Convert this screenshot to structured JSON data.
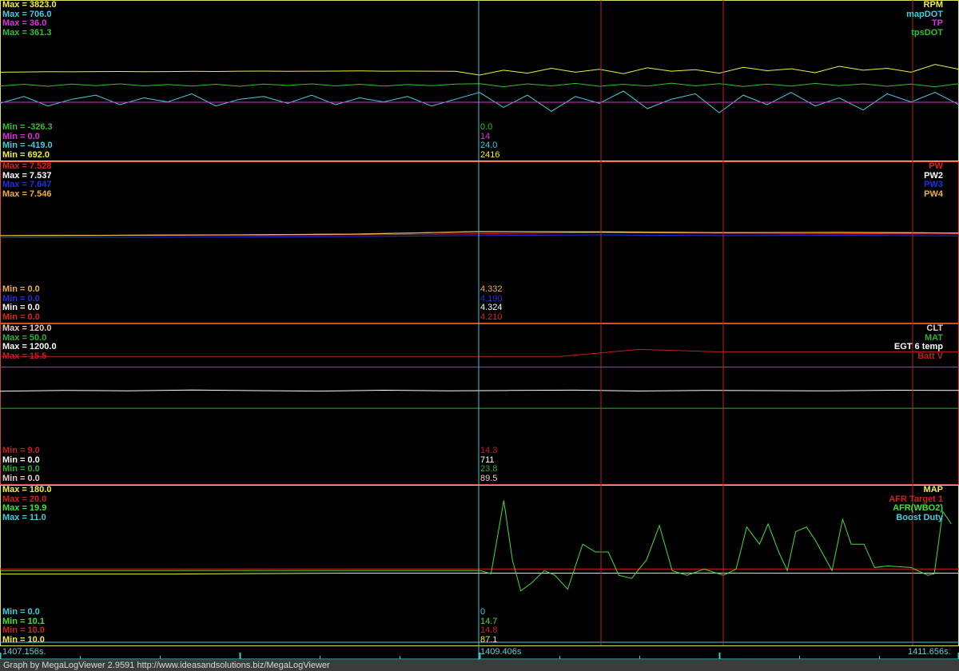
{
  "chart_data": {
    "type": "line",
    "title": "MegaLogViewer log graph",
    "x_range": [
      1407.156,
      1411.656
    ],
    "cursor_time_label": "1409.406s",
    "x_start_label": "1407.156s.",
    "x_end_label": "1411.656s.",
    "panels": [
      {
        "series": [
          {
            "name": "RPM",
            "color": "#f0f040",
            "max_label": "Max = 3823.0",
            "min_label": "Min = 692.0",
            "cursor_value": "2416",
            "max": 3823.0,
            "min": 692.0,
            "values": [
              2440,
              2445,
              2450,
              2448,
              2452,
              2455,
              2450,
              2452,
              2458,
              2455,
              2460,
              2462,
              2458,
              2460,
              2462,
              2465,
              2460,
              2462,
              2460,
              2458,
              2380,
              2480,
              2420,
              2520,
              2440,
              2500,
              2410,
              2530,
              2460,
              2490,
              2420,
              2540,
              2470,
              2510,
              2430,
              2560,
              2480,
              2520,
              2440,
              2600,
              2500
            ]
          },
          {
            "name": "mapDOT",
            "color": "#40d0e0",
            "max_label": "Max = 706.0",
            "min_label": "Min = -419.0",
            "cursor_value": "24.0",
            "max": 706.0,
            "min": -419.0,
            "values": [
              -20,
              30,
              -40,
              10,
              40,
              -30,
              20,
              -10,
              50,
              -40,
              10,
              30,
              -20,
              40,
              -30,
              20,
              -10,
              30,
              -40,
              10,
              60,
              -50,
              40,
              -80,
              30,
              -20,
              70,
              -60,
              10,
              50,
              -90,
              40,
              -30,
              60,
              -40,
              20,
              -70,
              50,
              -10,
              60,
              -30
            ]
          },
          {
            "name": "TP",
            "color": "#e030e0",
            "max_label": "Max = 36.0",
            "min_label": "Min = 0.0",
            "cursor_value": "14",
            "max": 36.0,
            "min": 0.0,
            "values": [
              13,
              13
            ]
          },
          {
            "name": "tpsDOT",
            "color": "#30c030",
            "max_label": "Max = 361.3",
            "min_label": "Min = -326.3",
            "cursor_value": "0.0",
            "max": 361.3,
            "min": -326.3,
            "values": [
              -5,
              3,
              -6,
              4,
              -3,
              5,
              -4,
              2,
              -5,
              3,
              -6,
              4,
              -2,
              5,
              -4,
              3,
              -5,
              2,
              -3,
              4,
              6,
              -8,
              5,
              -4,
              7,
              -6,
              3,
              -5,
              8,
              -4,
              6,
              -7,
              4,
              -5,
              7,
              -3,
              5,
              -6,
              4,
              -8,
              6
            ]
          }
        ],
        "border": "#e0e060"
      },
      {
        "series": [
          {
            "name": "PW",
            "color": "#e02020",
            "max_label": "Max = 7.528",
            "min_label": "Min = 0.0",
            "cursor_value": "4.210",
            "max": 7.528,
            "min": 0.0,
            "values": [
              4.1,
              4.12,
              4.14,
              4.16,
              4.21,
              4.26,
              4.24,
              4.22,
              4.2
            ]
          },
          {
            "name": "PW2",
            "color": "#ffffff",
            "max_label": "Max = 7.537",
            "min_label": "Min = 0.0",
            "cursor_value": "4.324",
            "max": 7.537,
            "min": 0.0,
            "values": [
              4.12,
              4.14,
              4.16,
              4.2,
              4.32,
              4.3,
              4.27,
              4.28,
              4.25
            ]
          },
          {
            "name": "PW3",
            "color": "#2030e0",
            "max_label": "Max = 7.647",
            "min_label": "Min = 0.0",
            "cursor_value": "4.190",
            "max": 7.647,
            "min": 0.0,
            "values": [
              4.08,
              4.1,
              4.12,
              4.14,
              4.19,
              4.22,
              4.18,
              4.2,
              4.17
            ]
          },
          {
            "name": "PW4",
            "color": "#f0b040",
            "max_label": "Max = 7.546",
            "min_label": "Min = 0.0",
            "cursor_value": "4.332",
            "max": 7.546,
            "min": 0.0,
            "values": [
              4.13,
              4.15,
              4.17,
              4.21,
              4.33,
              4.32,
              4.28,
              4.29,
              4.26
            ]
          }
        ],
        "border": "#e05030"
      },
      {
        "series": [
          {
            "name": "CLT",
            "color": "#f0c8c8",
            "max_label": "Max = 120.0",
            "min_label": "Min = 0.0",
            "cursor_value": "89.5",
            "max": 120.0,
            "min": 0.0,
            "line_color": "#c04040",
            "values": [
              89.5,
              89.5
            ]
          },
          {
            "name": "MAT",
            "color": "#30b030",
            "max_label": "Max = 50.0",
            "min_label": "Min = 0.0",
            "cursor_value": "23.8",
            "max": 50.0,
            "min": 0.0,
            "values": [
              23.8,
              23.8
            ]
          },
          {
            "name": "EGT 6 temp",
            "color": "#ffffff",
            "max_label": "Max = 1200.0",
            "min_label": "Min = 0.0",
            "cursor_value": "711",
            "max": 1200.0,
            "min": 0.0,
            "values": [
              705,
              712,
              708,
              715,
              710,
              706,
              713,
              709,
              711,
              714,
              707,
              712,
              710,
              708,
              713,
              711
            ]
          },
          {
            "name": "Batt V",
            "color": "#c02020",
            "max_label": "Max = 15.5",
            "min_label": "Min = 9.0",
            "cursor_value": "14.3",
            "max": 15.5,
            "min": 9.0,
            "values": [
              14.3,
              14.3,
              14.3,
              14.3,
              14.3,
              14.3,
              14.3,
              14.3,
              14.6,
              14.5,
              14.5,
              14.5,
              14.5
            ]
          }
        ],
        "border": "#d04050"
      },
      {
        "series": [
          {
            "name": "MAP",
            "color": "#f0f040",
            "max_label": "Max = 180.0",
            "min_label": "Min = 10.0",
            "cursor_value": "87.1",
            "max": 180.0,
            "min": 10.0,
            "values": [
              86,
              86,
              86,
              86.5,
              87,
              87,
              87,
              87,
              87.1,
              87,
              87,
              87
            ]
          },
          {
            "name": "AFR Target 1",
            "color": "#d02020",
            "max_label": "Max = 20.0",
            "min_label": "Min = 10.0",
            "cursor_value": "14.8",
            "max": 20.0,
            "min": 10.0,
            "values": [
              14.8,
              14.8
            ]
          },
          {
            "name": "AFR(WBO2)",
            "color": "#40e040",
            "max_label": "Max = 19.9",
            "min_label": "Min = 10.1",
            "cursor_value": "14.7",
            "max": 19.9,
            "min": 10.1,
            "times": [
              1407.16,
              1409.41,
              1409.46,
              1409.52,
              1409.56,
              1409.6,
              1409.65,
              1409.71,
              1409.76,
              1409.82,
              1409.89,
              1409.95,
              1410.01,
              1410.06,
              1410.12,
              1410.19,
              1410.25,
              1410.31,
              1410.38,
              1410.46,
              1410.55,
              1410.61,
              1410.66,
              1410.72,
              1410.76,
              1410.81,
              1410.85,
              1410.89,
              1410.94,
              1410.98,
              1411.06,
              1411.11,
              1411.15,
              1411.21,
              1411.26,
              1411.32,
              1411.43,
              1411.51,
              1411.54,
              1411.58,
              1411.62
            ],
            "values": [
              14.7,
              14.7,
              14.5,
              19.2,
              15.4,
              13.4,
              13.9,
              14.7,
              14.4,
              13.5,
              16.4,
              15.9,
              15.9,
              14.4,
              14.2,
              15.4,
              17.6,
              14.7,
              14.4,
              14.8,
              14.4,
              14.8,
              17.5,
              16.4,
              17.7,
              15.9,
              14.7,
              17.2,
              17.5,
              16.7,
              14.7,
              18.0,
              16.4,
              16.4,
              14.9,
              15.0,
              14.9,
              14.4,
              14.5,
              18.5,
              17.7
            ]
          },
          {
            "name": "Boost Duty",
            "color": "#40d0e0",
            "max_label": "Max = 11.0",
            "min_label": "Min = 0.0",
            "cursor_value": "0",
            "max": 11.0,
            "min": 0.0,
            "values": [
              0,
              0
            ]
          }
        ],
        "border": "#e0e060"
      }
    ]
  },
  "footer": "Graph by MegaLogViewer 2.9591 http://www.ideasandsolutions.biz/MegaLogViewer",
  "colors": {
    "cursor": "#40c8c8",
    "marker": "#c02020",
    "background": "#000000"
  }
}
